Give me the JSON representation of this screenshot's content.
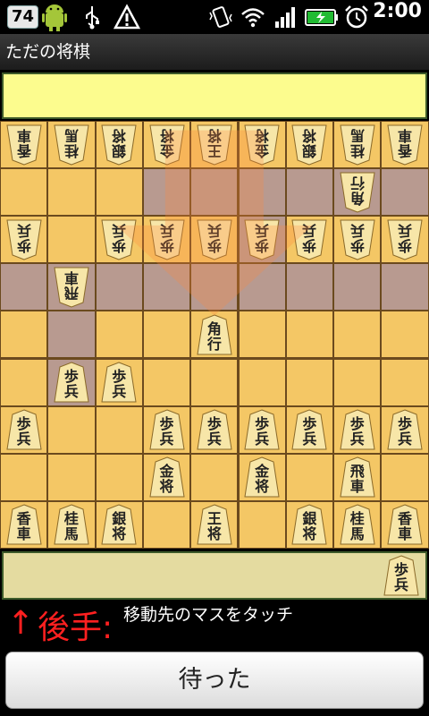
{
  "status_bar": {
    "notification_count": "74",
    "time": "2:00",
    "icons": [
      "android-icon",
      "usb-icon",
      "warning-icon",
      "vibrate-icon",
      "wifi-icon",
      "signal-icon",
      "battery-icon",
      "alarm-icon"
    ]
  },
  "app": {
    "title": "ただの将棋"
  },
  "board": {
    "highlighted_squares": [
      [
        3,
        1
      ],
      [
        4,
        1
      ],
      [
        5,
        1
      ],
      [
        6,
        1
      ],
      [
        7,
        1
      ],
      [
        8,
        1
      ],
      [
        0,
        3
      ],
      [
        1,
        3
      ],
      [
        2,
        3
      ],
      [
        3,
        3
      ],
      [
        4,
        3
      ],
      [
        5,
        3
      ],
      [
        6,
        3
      ],
      [
        7,
        3
      ],
      [
        8,
        3
      ],
      [
        1,
        4
      ],
      [
        1,
        5
      ],
      [
        5,
        2
      ]
    ],
    "pieces": [
      {
        "row": 0,
        "col": 0,
        "t1": "香",
        "t2": "車",
        "side": "gote"
      },
      {
        "row": 0,
        "col": 1,
        "t1": "桂",
        "t2": "馬",
        "side": "gote"
      },
      {
        "row": 0,
        "col": 2,
        "t1": "銀",
        "t2": "将",
        "side": "gote"
      },
      {
        "row": 0,
        "col": 3,
        "t1": "金",
        "t2": "将",
        "side": "gote"
      },
      {
        "row": 0,
        "col": 4,
        "t1": "王",
        "t2": "将",
        "side": "gote"
      },
      {
        "row": 0,
        "col": 5,
        "t1": "金",
        "t2": "将",
        "side": "gote"
      },
      {
        "row": 0,
        "col": 6,
        "t1": "銀",
        "t2": "将",
        "side": "gote"
      },
      {
        "row": 0,
        "col": 7,
        "t1": "桂",
        "t2": "馬",
        "side": "gote"
      },
      {
        "row": 0,
        "col": 8,
        "t1": "香",
        "t2": "車",
        "side": "gote"
      },
      {
        "row": 1,
        "col": 7,
        "t1": "角",
        "t2": "行",
        "side": "gote"
      },
      {
        "row": 2,
        "col": 0,
        "t1": "歩",
        "t2": "兵",
        "side": "gote"
      },
      {
        "row": 2,
        "col": 2,
        "t1": "歩",
        "t2": "兵",
        "side": "gote"
      },
      {
        "row": 2,
        "col": 3,
        "t1": "歩",
        "t2": "兵",
        "side": "gote"
      },
      {
        "row": 2,
        "col": 4,
        "t1": "歩",
        "t2": "兵",
        "side": "gote"
      },
      {
        "row": 2,
        "col": 5,
        "t1": "歩",
        "t2": "兵",
        "side": "gote"
      },
      {
        "row": 2,
        "col": 6,
        "t1": "歩",
        "t2": "兵",
        "side": "gote"
      },
      {
        "row": 2,
        "col": 7,
        "t1": "歩",
        "t2": "兵",
        "side": "gote"
      },
      {
        "row": 2,
        "col": 8,
        "t1": "歩",
        "t2": "兵",
        "side": "gote"
      },
      {
        "row": 3,
        "col": 1,
        "t1": "飛",
        "t2": "車",
        "side": "gote"
      },
      {
        "row": 4,
        "col": 4,
        "t1": "角",
        "t2": "行",
        "side": "sente"
      },
      {
        "row": 5,
        "col": 1,
        "t1": "歩",
        "t2": "兵",
        "side": "sente"
      },
      {
        "row": 5,
        "col": 2,
        "t1": "歩",
        "t2": "兵",
        "side": "sente"
      },
      {
        "row": 6,
        "col": 0,
        "t1": "歩",
        "t2": "兵",
        "side": "sente"
      },
      {
        "row": 6,
        "col": 3,
        "t1": "歩",
        "t2": "兵",
        "side": "sente"
      },
      {
        "row": 6,
        "col": 4,
        "t1": "歩",
        "t2": "兵",
        "side": "sente"
      },
      {
        "row": 6,
        "col": 5,
        "t1": "歩",
        "t2": "兵",
        "side": "sente"
      },
      {
        "row": 6,
        "col": 6,
        "t1": "歩",
        "t2": "兵",
        "side": "sente"
      },
      {
        "row": 6,
        "col": 7,
        "t1": "歩",
        "t2": "兵",
        "side": "sente"
      },
      {
        "row": 6,
        "col": 8,
        "t1": "歩",
        "t2": "兵",
        "side": "sente"
      },
      {
        "row": 7,
        "col": 3,
        "t1": "金",
        "t2": "将",
        "side": "sente"
      },
      {
        "row": 7,
        "col": 5,
        "t1": "金",
        "t2": "将",
        "side": "sente"
      },
      {
        "row": 7,
        "col": 7,
        "t1": "飛",
        "t2": "車",
        "side": "sente"
      },
      {
        "row": 8,
        "col": 0,
        "t1": "香",
        "t2": "車",
        "side": "sente"
      },
      {
        "row": 8,
        "col": 1,
        "t1": "桂",
        "t2": "馬",
        "side": "sente"
      },
      {
        "row": 8,
        "col": 2,
        "t1": "銀",
        "t2": "将",
        "side": "sente"
      },
      {
        "row": 8,
        "col": 4,
        "t1": "王",
        "t2": "将",
        "side": "sente"
      },
      {
        "row": 8,
        "col": 6,
        "t1": "銀",
        "t2": "将",
        "side": "sente"
      },
      {
        "row": 8,
        "col": 7,
        "t1": "桂",
        "t2": "馬",
        "side": "sente"
      },
      {
        "row": 8,
        "col": 8,
        "t1": "香",
        "t2": "車",
        "side": "sente"
      }
    ]
  },
  "captured_bottom": [
    {
      "t1": "歩",
      "t2": "兵"
    }
  ],
  "turn": {
    "arrow": "↑",
    "label": "後手:"
  },
  "message": "移動先のマスをタッチ",
  "undo_button": "待った",
  "colors": {
    "board": "#f4c765",
    "highlight": "#b89a90",
    "piece": "#f7e6a8",
    "turn": "#ff2020"
  }
}
